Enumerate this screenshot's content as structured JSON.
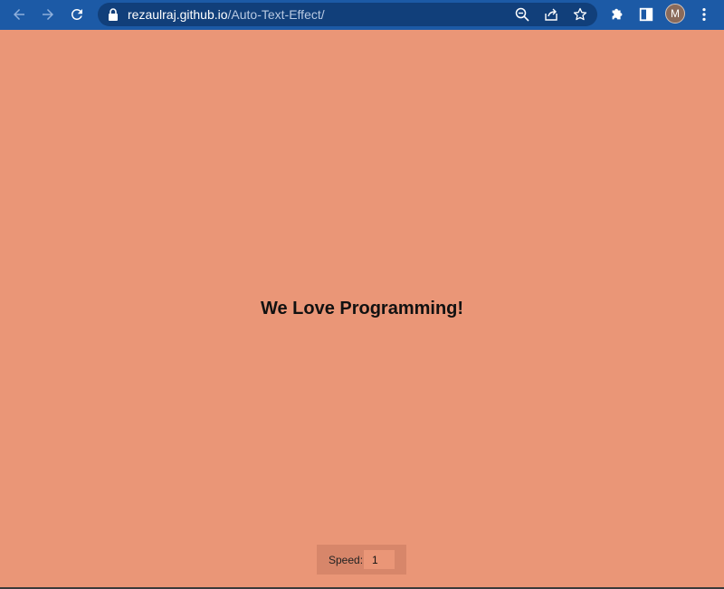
{
  "browser": {
    "url_host": "rezaulraj.github.io",
    "url_path": "/Auto-Text-Effect/",
    "profile_initial": "M",
    "chrome_color": "#1c5aa6",
    "omnibox_color": "#113f7a",
    "icons": {
      "back": "arrow-left-icon",
      "forward": "arrow-right-icon",
      "reload": "reload-icon",
      "lock": "lock-icon",
      "zoom": "zoom-out-icon",
      "share": "share-icon",
      "bookmark": "star-icon",
      "extensions": "puzzle-icon",
      "side_panel": "side-panel-icon",
      "menu": "kebab-menu-icon"
    }
  },
  "page": {
    "background_color": "#ea9677",
    "headline": "We Love Programming!",
    "speed": {
      "label": "Speed:",
      "value": "1"
    }
  }
}
